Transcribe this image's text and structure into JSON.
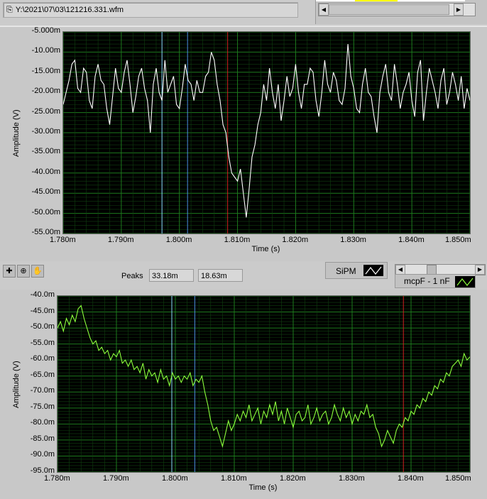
{
  "header": {
    "file_path": "Y:\\2021\\07\\03\\121216.331.wfm",
    "path_icon": "path-icon"
  },
  "toolbar": {
    "peaks_label": "Peaks",
    "peak1": "33.18m",
    "peak2": "18.63m",
    "tools": [
      "cursor-move-icon",
      "zoom-icon",
      "pan-hand-icon"
    ]
  },
  "legends": {
    "top_series": "SiPM",
    "bottom_series": "mcpF - 1 nF"
  },
  "colors": {
    "top_trace": "#ffffff",
    "bottom_trace": "#8cff3c",
    "grid_major": "#1d7a1d",
    "grid_minor": "#0f3f0f",
    "cursor1": "#8ad8ff",
    "cursor2": "#4a8ce0",
    "cursor3": "#d02020"
  },
  "chart_data": [
    {
      "type": "line",
      "title": "SiPM",
      "xlabel": "Time (s)",
      "ylabel": "Amplitude (V)",
      "xlim": [
        0.00178,
        0.00185
      ],
      "ylim": [
        -55,
        -5
      ],
      "x_ticks": [
        "1.780m",
        "1.790m",
        "1.800m",
        "1.810m",
        "1.820m",
        "1.830m",
        "1.840m",
        "1.850m"
      ],
      "y_ticks": [
        "-5.000m",
        "-10.00m",
        "-15.00m",
        "-20.00m",
        "-25.00m",
        "-30.00m",
        "-35.00m",
        "-40.00m",
        "-45.00m",
        "-50.00m",
        "-55.00m"
      ],
      "y_tick_values": [
        -5,
        -10,
        -15,
        -20,
        -25,
        -30,
        -35,
        -40,
        -45,
        -50,
        -55
      ],
      "cursors_ms": [
        1.797,
        1.8014,
        1.8083
      ],
      "x_start_ms": 1.78,
      "x_step_ms": 0.0005,
      "values": [
        -23,
        -20,
        -17,
        -13,
        -12,
        -19,
        -20,
        -14,
        -15,
        -22,
        -24,
        -16,
        -13,
        -17,
        -18,
        -24,
        -28,
        -21,
        -14,
        -19,
        -20,
        -15,
        -12,
        -18,
        -25,
        -21,
        -16,
        -14,
        -19,
        -22,
        -30,
        -18,
        -14,
        -20,
        -22,
        -12,
        -20,
        -18,
        -16,
        -23,
        -24,
        -19,
        -13,
        -17,
        -18,
        -22,
        -17,
        -20,
        -20,
        -16,
        -15,
        -10,
        -12,
        -18,
        -22,
        -28,
        -30,
        -36,
        -40,
        -41,
        -42,
        -39,
        -45,
        -51,
        -44,
        -36,
        -33,
        -28,
        -25,
        -18,
        -22,
        -14,
        -20,
        -24,
        -18,
        -27,
        -22,
        -16,
        -21,
        -19,
        -13,
        -20,
        -24,
        -18,
        -18,
        -14,
        -15,
        -22,
        -26,
        -20,
        -12,
        -18,
        -20,
        -15,
        -17,
        -22,
        -23,
        -19,
        -8,
        -16,
        -19,
        -24,
        -25,
        -18,
        -14,
        -20,
        -21,
        -26,
        -30,
        -20,
        -16,
        -13,
        -20,
        -22,
        -13,
        -18,
        -24,
        -20,
        -18,
        -15,
        -22,
        -26,
        -15,
        -12,
        -27,
        -20,
        -14,
        -17,
        -20,
        -24,
        -17,
        -14,
        -23,
        -20,
        -15,
        -18,
        -22,
        -16,
        -24,
        -19,
        -22
      ]
    },
    {
      "type": "line",
      "title": "mcpF - 1 nF",
      "xlabel": "Time (s)",
      "ylabel": "Amplitude (V)",
      "xlim": [
        0.00178,
        0.00185
      ],
      "ylim": [
        -95,
        -40
      ],
      "x_ticks": [
        "1.780m",
        "1.790m",
        "1.800m",
        "1.810m",
        "1.820m",
        "1.830m",
        "1.840m",
        "1.850m"
      ],
      "y_ticks": [
        "-40.0m",
        "-45.0m",
        "-50.0m",
        "-55.0m",
        "-60.0m",
        "-65.0m",
        "-70.0m",
        "-75.0m",
        "-80.0m",
        "-85.0m",
        "-90.0m",
        "-95.0m"
      ],
      "y_tick_values": [
        -40,
        -45,
        -50,
        -55,
        -60,
        -65,
        -70,
        -75,
        -80,
        -85,
        -90,
        -95
      ],
      "cursors_ms": [
        1.7994,
        1.8033,
        1.8387
      ],
      "x_start_ms": 1.78,
      "x_step_ms": 0.0005,
      "values": [
        -50,
        -48,
        -51,
        -47,
        -49,
        -46,
        -48,
        -44,
        -43,
        -47,
        -50,
        -53,
        -55,
        -54,
        -57,
        -56,
        -58,
        -57,
        -60,
        -58,
        -59,
        -57,
        -61,
        -60,
        -62,
        -60,
        -63,
        -62,
        -64,
        -61,
        -66,
        -63,
        -65,
        -64,
        -67,
        -63,
        -66,
        -65,
        -68,
        -64,
        -66,
        -65,
        -67,
        -65,
        -66,
        -64,
        -68,
        -66,
        -67,
        -65,
        -70,
        -74,
        -79,
        -82,
        -81,
        -84,
        -87,
        -83,
        -79,
        -82,
        -80,
        -77,
        -79,
        -76,
        -78,
        -74,
        -79,
        -77,
        -75,
        -80,
        -76,
        -78,
        -74,
        -77,
        -73,
        -79,
        -76,
        -80,
        -75,
        -78,
        -81,
        -77,
        -76,
        -79,
        -78,
        -74,
        -80,
        -78,
        -75,
        -79,
        -77,
        -76,
        -80,
        -78,
        -74,
        -77,
        -79,
        -75,
        -78,
        -76,
        -80,
        -77,
        -79,
        -76,
        -77,
        -74,
        -78,
        -77,
        -81,
        -83,
        -87,
        -85,
        -82,
        -84,
        -86,
        -82,
        -80,
        -81,
        -78,
        -79,
        -76,
        -77,
        -74,
        -75,
        -72,
        -73,
        -70,
        -71,
        -68,
        -69,
        -66,
        -67,
        -64,
        -65,
        -62,
        -61,
        -60,
        -62,
        -58,
        -60,
        -59
      ]
    }
  ]
}
